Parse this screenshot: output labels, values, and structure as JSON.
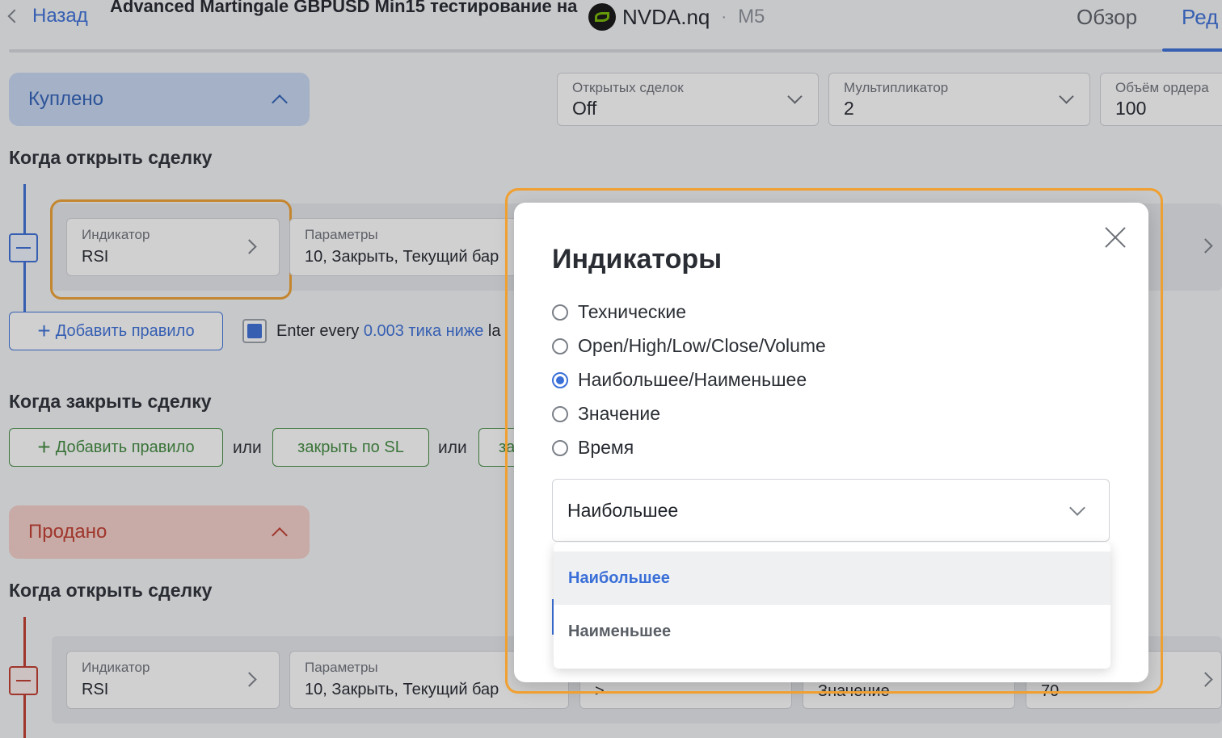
{
  "header": {
    "back_label": "Назад",
    "strategy_title": "Advanced Martingale GBPUSD Min15 тестирование на",
    "symbol": "NVDA.nq",
    "separator": "·",
    "timeframe": "M5",
    "tabs": [
      {
        "label": "Обзор",
        "active": false
      },
      {
        "label": "Ред",
        "active": true
      }
    ]
  },
  "bought": {
    "label": "Куплено",
    "settings": [
      {
        "label": "Открытых сделок",
        "value": "Off"
      },
      {
        "label": "Мультипликатор",
        "value": "2"
      },
      {
        "label": "Объём ордера",
        "value": "100"
      }
    ],
    "open_heading": "Когда открыть сделку",
    "rule": {
      "indicator_label": "Индикатор",
      "indicator_value": "RSI",
      "params_label": "Параметры",
      "params_value": "10, Закрыть, Текущий бар"
    },
    "add_rule": "Добавить правило",
    "every_prefix": "Enter every",
    "every_link": "0.003 тика ниже",
    "every_suffix": "la",
    "close_heading": "Когда закрыть сделку",
    "close_add_rule": "Добавить правило",
    "or_1": "или",
    "close_sl": "закрыть по SL",
    "or_2": "или",
    "close_more": "за"
  },
  "sold": {
    "label": "Продано",
    "open_heading": "Когда открыть сделку",
    "rule": {
      "indicator_label": "Индикатор",
      "indicator_value": "RSI",
      "params_label": "Параметры",
      "params_value": "10, Закрыть, Текущий бар",
      "op_value": ">",
      "compare_value": "Значение",
      "number_value": "70"
    }
  },
  "modal": {
    "title": "Индикаторы",
    "options": [
      {
        "label": "Технические",
        "selected": false
      },
      {
        "label": "Open/High/Low/Close/Volume",
        "selected": false
      },
      {
        "label": "Наибольшее/Наименьшее",
        "selected": true
      },
      {
        "label": "Значение",
        "selected": false
      },
      {
        "label": "Время",
        "selected": false
      }
    ],
    "select_value": "Наибольшее",
    "dropdown_options": [
      {
        "label": "Наибольшее",
        "active": true
      },
      {
        "label": "Наименьшее",
        "active": false
      }
    ]
  },
  "colors": {
    "accent": "#3a6fd8",
    "buy_bg": "#c7d8f2",
    "sell_bg": "#f5cfc8",
    "sell_text": "#c0392b",
    "green": "#3f8a3c",
    "highlight": "#f0a030"
  },
  "icons": [
    "chevron-left-icon",
    "nvidia-logo-icon",
    "chevron-up-icon",
    "chevron-down-icon",
    "chevron-right-icon",
    "minus-icon",
    "plus-icon",
    "close-icon",
    "radio-icon"
  ]
}
